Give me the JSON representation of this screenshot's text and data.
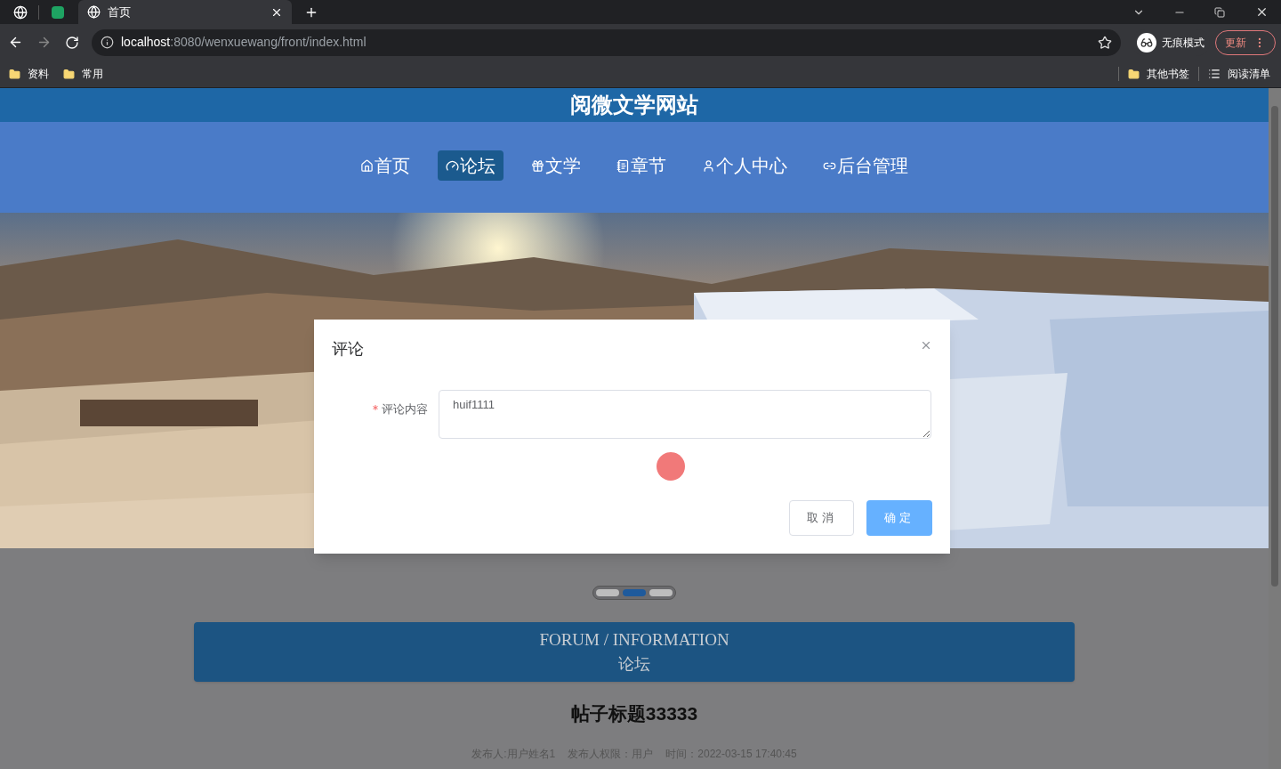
{
  "browser": {
    "tabs": [
      {
        "title": "首页",
        "selected": true
      }
    ],
    "address": {
      "host": "localhost",
      "path": ":8080/wenxuewang/front/index.html"
    },
    "profile": "无痕模式",
    "update_button": "更新",
    "bookmarks": [
      "资料",
      "常用"
    ],
    "other_bookmarks": "其他书签",
    "reading_list": "阅读清单"
  },
  "site": {
    "title": "阅微文学网站",
    "nav": [
      {
        "label": "首页",
        "selected": false
      },
      {
        "label": "论坛",
        "selected": true
      },
      {
        "label": "文学",
        "selected": false
      },
      {
        "label": "章节",
        "selected": false
      },
      {
        "label": "个人中心",
        "selected": false
      },
      {
        "label": "后台管理",
        "selected": false
      }
    ],
    "carousel_dots": [
      {
        "selected": false
      },
      {
        "selected": true
      },
      {
        "selected": false
      }
    ],
    "section": {
      "title_en": "FORUM / INFORMATION",
      "title_zh": "论坛"
    },
    "post": {
      "title": "帖子标题33333",
      "meta": [
        "发布人:用户姓名1",
        "发布人权限：用户",
        "时间：2022-03-15 17:40:45"
      ]
    }
  },
  "dialog": {
    "title": "评论",
    "field": {
      "label": "评论内容",
      "required": true,
      "value": "huif1111"
    },
    "buttons": [
      "取消",
      "确定"
    ]
  }
}
